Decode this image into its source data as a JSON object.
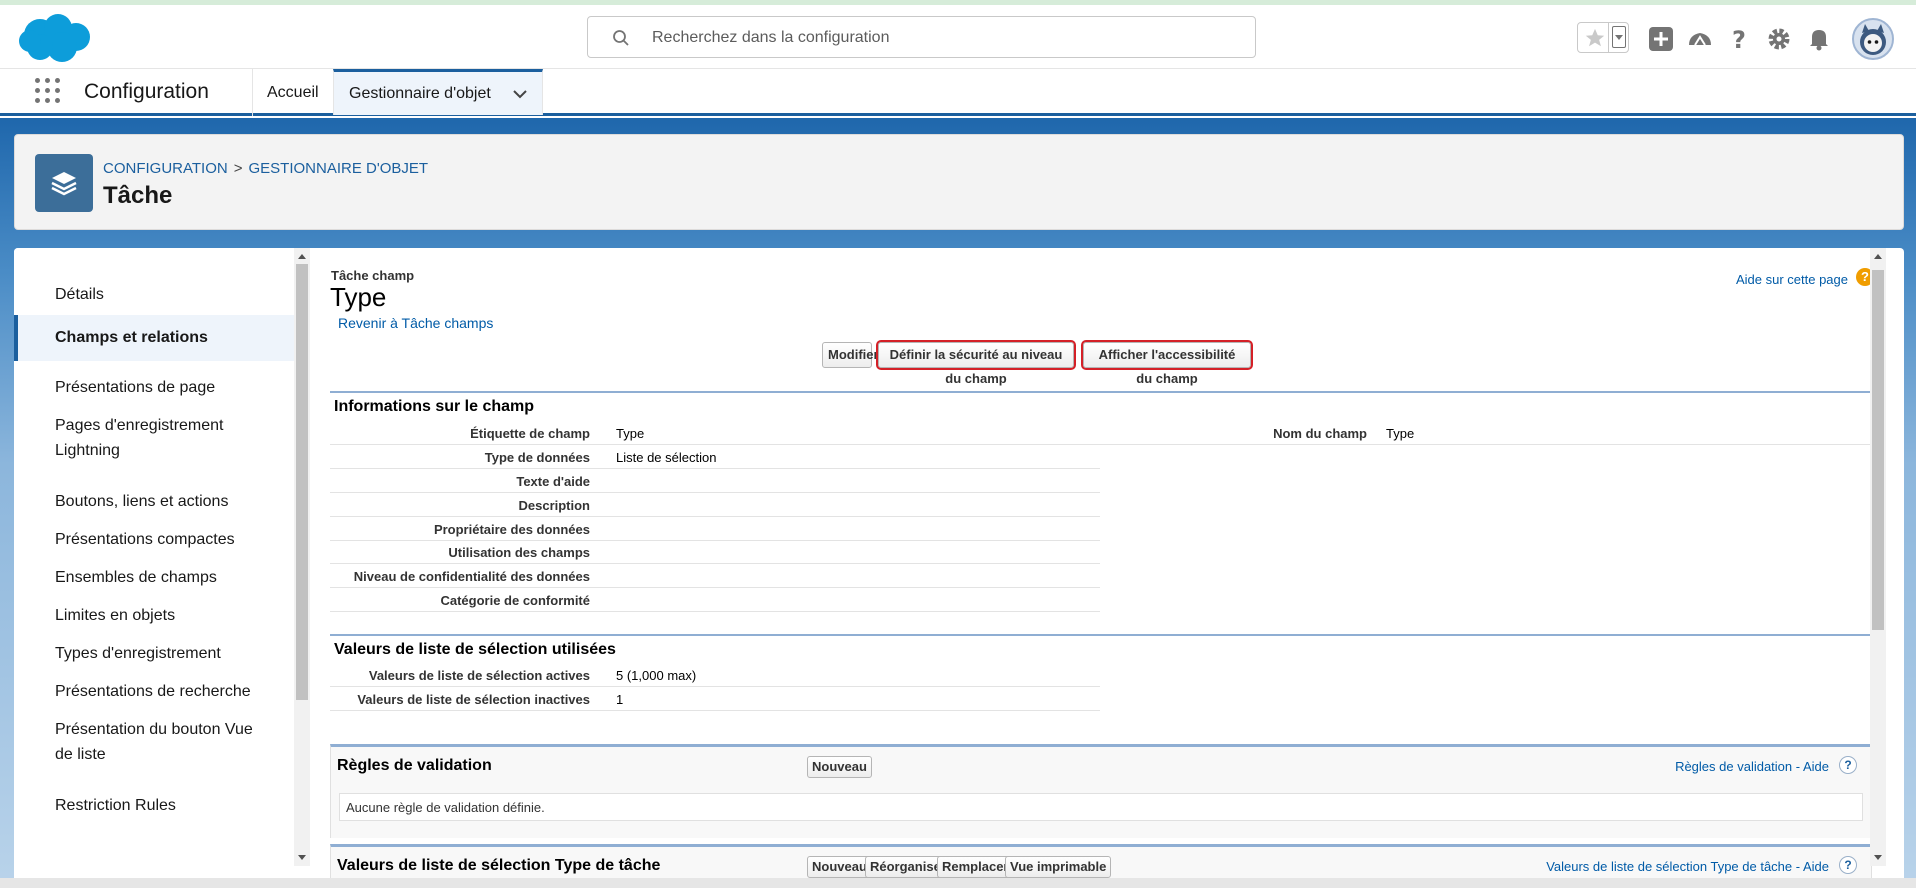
{
  "header": {
    "search_placeholder": "Recherchez dans la configuration",
    "icons": [
      "cloud-logo",
      "search-icon",
      "star-icon",
      "chevron-down-icon",
      "add-icon",
      "trailhead-icon",
      "help-icon",
      "gear-icon",
      "bell-icon",
      "avatar"
    ]
  },
  "appnav": {
    "app_name": "Configuration",
    "tabs": [
      {
        "label": "Accueil"
      },
      {
        "label": "Gestionnaire d'objet"
      }
    ]
  },
  "page_header": {
    "breadcrumb": [
      "CONFIGURATION",
      "GESTIONNAIRE D'OBJET"
    ],
    "breadcrumb_sep": ">",
    "title": "Tâche"
  },
  "sidebar": {
    "items": [
      {
        "label": "Détails"
      },
      {
        "label": "Champs et relations"
      },
      {
        "label": "Présentations de page"
      },
      {
        "label": "Pages d'enregistrement Lightning"
      },
      {
        "label": "Boutons, liens et actions"
      },
      {
        "label": "Présentations compactes"
      },
      {
        "label": "Ensembles de champs"
      },
      {
        "label": "Limites en objets"
      },
      {
        "label": "Types d'enregistrement"
      },
      {
        "label": "Présentations de recherche"
      },
      {
        "label": "Présentation du bouton Vue de liste"
      },
      {
        "label": "Restriction Rules"
      }
    ],
    "active_index": 1
  },
  "content": {
    "object_field": "Tâche champ",
    "title": "Type",
    "back_link": "Revenir à Tâche champs",
    "help_link": "Aide sur cette page",
    "help_q": "?",
    "buttons": {
      "edit": "Modifier",
      "field_security": "Définir la sécurité au niveau du champ",
      "field_accessibility": "Afficher l'accessibilité du champ"
    },
    "field_info": {
      "title": "Informations sur le champ",
      "rows": [
        {
          "label": "Étiquette de champ",
          "value": "Type"
        },
        {
          "label": "Type de données",
          "value": "Liste de sélection"
        },
        {
          "label": "Texte d'aide",
          "value": ""
        },
        {
          "label": "Description",
          "value": ""
        },
        {
          "label": "Propriétaire des données",
          "value": ""
        },
        {
          "label": "Utilisation des champs",
          "value": ""
        },
        {
          "label": "Niveau de confidentialité des données",
          "value": ""
        },
        {
          "label": "Catégorie de conformité",
          "value": ""
        }
      ],
      "right": {
        "label": "Nom du champ",
        "value": "Type"
      }
    },
    "picklist_used": {
      "title": "Valeurs de liste de sélection utilisées",
      "rows": [
        {
          "label": "Valeurs de liste de sélection actives",
          "value": "5 (1,000 max)"
        },
        {
          "label": "Valeurs de liste de sélection inactives",
          "value": "1"
        }
      ]
    },
    "validation": {
      "title": "Règles de validation",
      "new_button": "Nouveau",
      "help": "Règles de validation - Aide",
      "empty": "Aucune règle de validation définie."
    },
    "picklist_values": {
      "title": "Valeurs de liste de sélection Type de tâche",
      "buttons": [
        "Nouveau",
        "Réorganiser",
        "Remplacer",
        "Vue imprimable"
      ],
      "help": "Valeurs de liste de sélection Type de tâche - Aide"
    }
  },
  "colors": {
    "brand": "#1b5f9e",
    "link": "#015ba7",
    "highlight": "#d42027"
  }
}
